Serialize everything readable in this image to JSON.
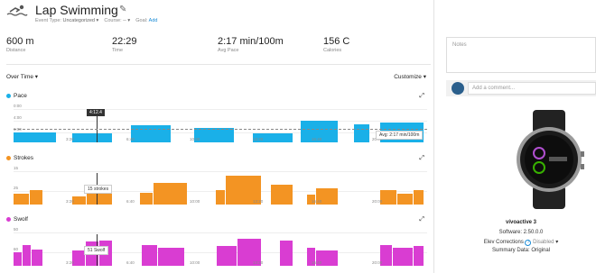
{
  "activity": {
    "title": "Lap Swimming",
    "event_type_label": "Event Type:",
    "event_type_value": "Uncategorized",
    "course_label": "Course:",
    "course_value": "--",
    "goal_label": "Goal:",
    "goal_value": "Add"
  },
  "stats": [
    {
      "value": "600 m",
      "label": "Distance"
    },
    {
      "value": "22:29",
      "label": "Time"
    },
    {
      "value": "2:17 min/100m",
      "label": "Avg Pace"
    },
    {
      "value": "156 C",
      "label": "Calories"
    }
  ],
  "controls": {
    "over_time": "Over Time",
    "customize": "Customize"
  },
  "chart_data": [
    {
      "type": "bar",
      "title": "Pace",
      "color": "#1ab0e8",
      "y_ticks": [
        "0:00",
        "4:00",
        "6:00"
      ],
      "x_ticks": [
        "3:20",
        "6:40",
        "10:00",
        "13:20",
        "16:40",
        "20:00"
      ],
      "note": "seconds per 100m, axis inverted (faster = taller)",
      "values": [
        166,
        170,
        140,
        150,
        170,
        125,
        137,
        130
      ],
      "cursor_label": "4:12.4",
      "avg_label": "Avg: 2:17 min/100m"
    },
    {
      "type": "bar",
      "title": "Strokes",
      "color": "#f39423",
      "y_ticks": [
        "15",
        "25"
      ],
      "x_ticks": [
        "3:20",
        "6:40",
        "10:00",
        "13:20",
        "16:40",
        "20:00"
      ],
      "values": [
        12,
        16,
        9,
        15,
        13,
        24,
        16,
        32,
        22,
        11,
        18,
        16,
        12,
        16
      ],
      "cursor_label": "15 strokes"
    },
    {
      "type": "bar",
      "title": "Swolf",
      "color": "#d93dd2",
      "y_ticks": [
        "50",
        "60"
      ],
      "x_ticks": [
        "3:20",
        "6:40",
        "10:00",
        "13:20",
        "16:40",
        "20:00"
      ],
      "values": [
        44,
        49,
        46,
        45,
        51,
        52,
        49,
        47,
        48,
        53,
        52,
        47,
        45,
        49,
        47,
        48
      ],
      "cursor_label": "51 Swolf"
    }
  ],
  "notes": {
    "placeholder": "Notes"
  },
  "comment": {
    "placeholder": "Add a comment..."
  },
  "device": {
    "name": "vívoactive 3",
    "software": "Software: 2.50.0.0",
    "elev_label": "Elev Corrections",
    "elev_value": "Disabled",
    "summary": "Summary Data: Original"
  }
}
